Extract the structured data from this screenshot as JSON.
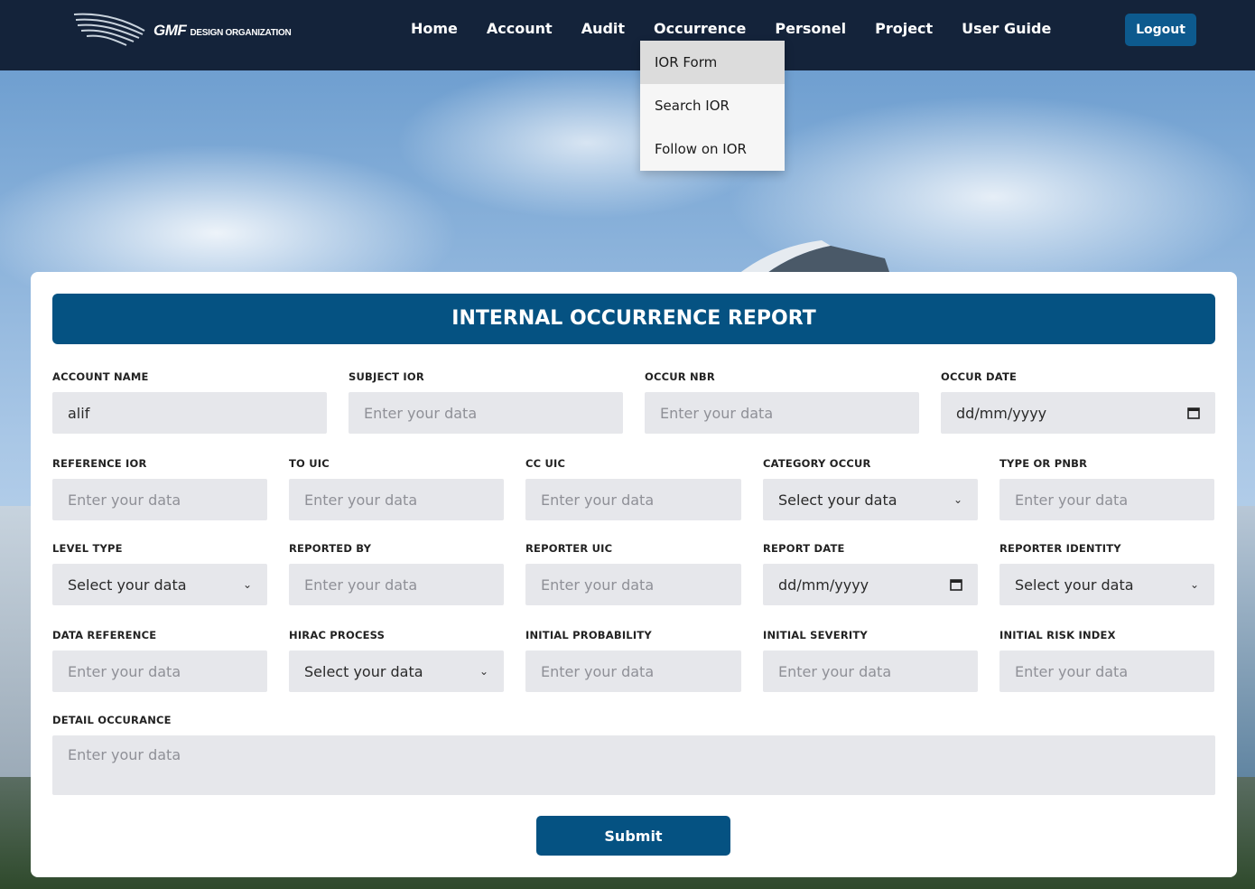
{
  "brand": {
    "name": "GMF",
    "sub": "DESIGN ORGANIZATION"
  },
  "nav": {
    "items": [
      "Home",
      "Account",
      "Audit",
      "Occurrence",
      "Personel",
      "Project",
      "User Guide"
    ],
    "logout_label": "Logout"
  },
  "occurrence_menu": [
    "IOR Form",
    "Search IOR",
    "Follow on IOR"
  ],
  "form": {
    "title": "INTERNAL OCCURRENCE REPORT",
    "placeholder": "Enter your data",
    "select_placeholder": "Select your data",
    "date_placeholder": "dd/mm/yyyy",
    "account_name": {
      "label": "ACCOUNT NAME",
      "value": "alif"
    },
    "subject_ior": {
      "label": "SUBJECT IOR"
    },
    "occur_nbr": {
      "label": "OCCUR NBR"
    },
    "occur_date": {
      "label": "OCCUR DATE"
    },
    "reference_ior": {
      "label": "REFERENCE IOR"
    },
    "to_uic": {
      "label": "TO UIC"
    },
    "cc_uic": {
      "label": "CC UIC"
    },
    "category_occur": {
      "label": "CATEGORY OCCUR"
    },
    "type_or_pnbr": {
      "label": "TYPE OR PNBR"
    },
    "level_type": {
      "label": "LEVEL TYPE"
    },
    "reported_by": {
      "label": "REPORTED BY"
    },
    "reporter_uic": {
      "label": "REPORTER UIC"
    },
    "report_date": {
      "label": "REPORT DATE"
    },
    "reporter_identity": {
      "label": "REPORTER IDENTITY"
    },
    "data_reference": {
      "label": "DATA REFERENCE"
    },
    "hirac_process": {
      "label": "HIRAC PROCESS"
    },
    "initial_probability": {
      "label": "INITIAL PROBABILITY"
    },
    "initial_severity": {
      "label": "INITIAL SEVERITY"
    },
    "initial_risk_index": {
      "label": "INITIAL RISK INDEX"
    },
    "detail_occurance": {
      "label": "DETAIL OCCURANCE"
    },
    "submit_label": "Submit"
  },
  "icons": {
    "calendar": "calendar-icon",
    "chevron": "chevron-down-icon"
  }
}
